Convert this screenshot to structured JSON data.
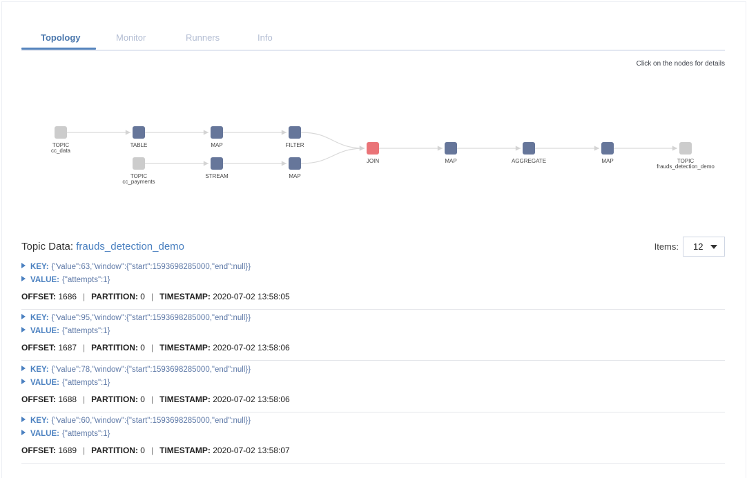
{
  "tabs": [
    {
      "label": "Topology",
      "active": true
    },
    {
      "label": "Monitor",
      "active": false
    },
    {
      "label": "Runners",
      "active": false
    },
    {
      "label": "Info",
      "active": false
    }
  ],
  "hint": "Click on the nodes for details",
  "colors": {
    "topic_node": "#cccccc",
    "processor_node": "#66769a",
    "join_node": "#ea7478",
    "accent": "#4a80c0",
    "edge": "#d9d9d9"
  },
  "graph": {
    "nodes": [
      {
        "id": "n_cc_data",
        "type": "topic",
        "title": "TOPIC",
        "sub": "cc_data"
      },
      {
        "id": "n_table",
        "type": "processor",
        "title": "TABLE",
        "sub": ""
      },
      {
        "id": "n_map1",
        "type": "processor",
        "title": "MAP",
        "sub": ""
      },
      {
        "id": "n_filter",
        "type": "processor",
        "title": "FILTER",
        "sub": ""
      },
      {
        "id": "n_cc_payments",
        "type": "topic",
        "title": "TOPIC",
        "sub": "cc_payments"
      },
      {
        "id": "n_stream",
        "type": "processor",
        "title": "STREAM",
        "sub": ""
      },
      {
        "id": "n_map2",
        "type": "processor",
        "title": "MAP",
        "sub": ""
      },
      {
        "id": "n_join",
        "type": "join",
        "title": "JOIN",
        "sub": ""
      },
      {
        "id": "n_map3",
        "type": "processor",
        "title": "MAP",
        "sub": ""
      },
      {
        "id": "n_aggregate",
        "type": "processor",
        "title": "AGGREGATE",
        "sub": ""
      },
      {
        "id": "n_map4",
        "type": "processor",
        "title": "MAP",
        "sub": ""
      },
      {
        "id": "n_out",
        "type": "topic",
        "title": "TOPIC",
        "sub": "frauds_detection_demo"
      }
    ],
    "edges": [
      [
        "n_cc_data",
        "n_table"
      ],
      [
        "n_table",
        "n_map1"
      ],
      [
        "n_map1",
        "n_filter"
      ],
      [
        "n_filter",
        "n_join"
      ],
      [
        "n_cc_payments",
        "n_stream"
      ],
      [
        "n_stream",
        "n_map2"
      ],
      [
        "n_map2",
        "n_join"
      ],
      [
        "n_join",
        "n_map3"
      ],
      [
        "n_map3",
        "n_aggregate"
      ],
      [
        "n_aggregate",
        "n_map4"
      ],
      [
        "n_map4",
        "n_out"
      ]
    ]
  },
  "topic_data": {
    "label": "Topic Data:",
    "topic": "frauds_detection_demo",
    "items_label": "Items:",
    "items_value": "12",
    "key_label": "KEY:",
    "value_label": "VALUE:",
    "offset_label": "OFFSET:",
    "partition_label": "PARTITION:",
    "timestamp_label": "TIMESTAMP:",
    "separator": "|",
    "records": [
      {
        "key": "{\"value\":63,\"window\":{\"start\":1593698285000,\"end\":null}}",
        "value": "{\"attempts\":1}",
        "offset": "1686",
        "partition": "0",
        "timestamp": "2020-07-02 13:58:05"
      },
      {
        "key": "{\"value\":95,\"window\":{\"start\":1593698285000,\"end\":null}}",
        "value": "{\"attempts\":1}",
        "offset": "1687",
        "partition": "0",
        "timestamp": "2020-07-02 13:58:06"
      },
      {
        "key": "{\"value\":78,\"window\":{\"start\":1593698285000,\"end\":null}}",
        "value": "{\"attempts\":1}",
        "offset": "1688",
        "partition": "0",
        "timestamp": "2020-07-02 13:58:06"
      },
      {
        "key": "{\"value\":60,\"window\":{\"start\":1593698285000,\"end\":null}}",
        "value": "{\"attempts\":1}",
        "offset": "1689",
        "partition": "0",
        "timestamp": "2020-07-02 13:58:07"
      }
    ]
  }
}
